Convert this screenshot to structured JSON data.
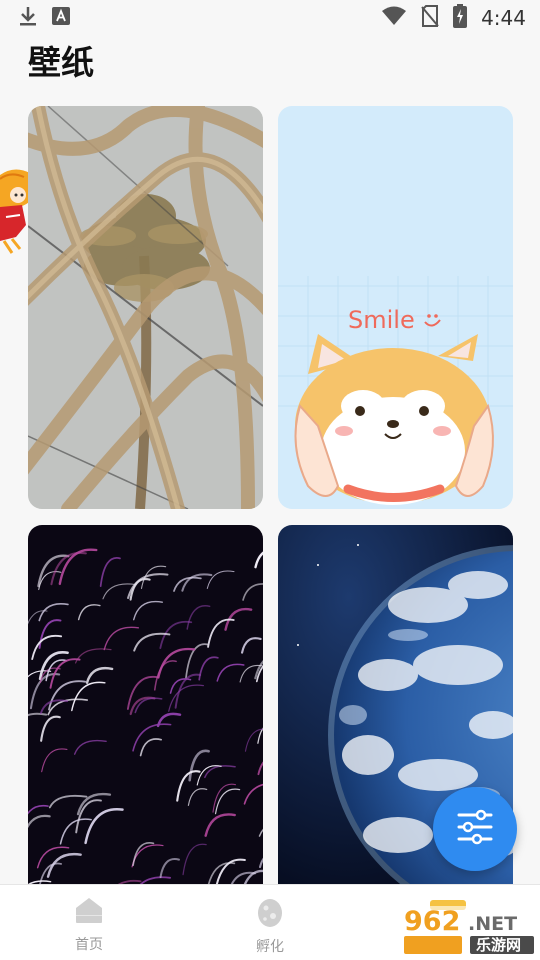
{
  "status_bar": {
    "time": "4:44",
    "left_icons": [
      "download-icon",
      "font-a-icon"
    ],
    "right_icons": [
      "wifi-icon",
      "no-sim-icon",
      "battery-charging-icon"
    ]
  },
  "header": {
    "title": "壁纸"
  },
  "wallpapers": [
    {
      "name": "palm-tree-behind-fence"
    },
    {
      "name": "shiba-dog-smile",
      "caption": "Smile"
    },
    {
      "name": "purple-light-streaks"
    },
    {
      "name": "earth-from-space"
    }
  ],
  "fab": {
    "icon": "filter-sliders-icon"
  },
  "bottom_nav": {
    "items": [
      {
        "label": "首页",
        "icon": "home-icon"
      },
      {
        "label": "孵化",
        "icon": "egg-icon"
      }
    ]
  },
  "watermark": {
    "main": "962",
    "suffix": ".NET",
    "sub": "乐游网"
  },
  "colors": {
    "accent": "#2f8bf0",
    "nav_label": "#9a9a9a",
    "watermark": "#f0a020"
  }
}
